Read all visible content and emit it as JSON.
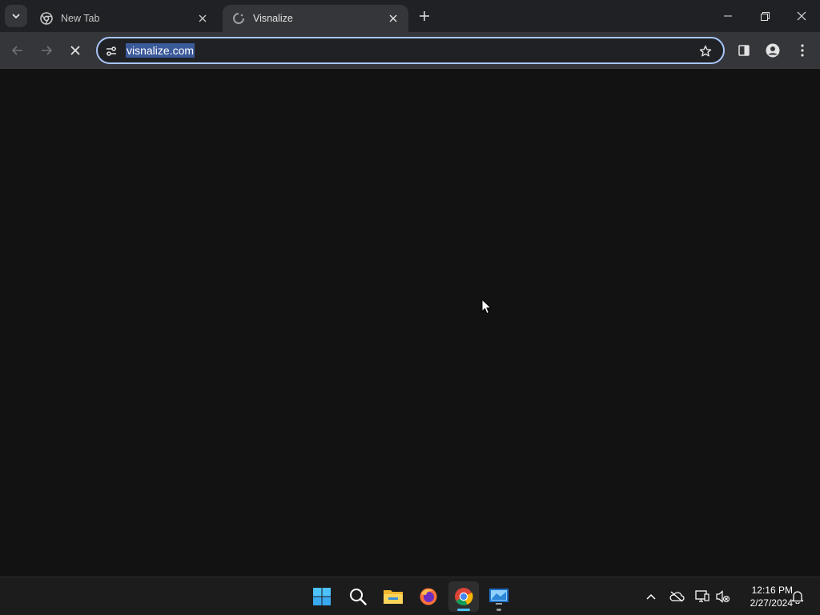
{
  "browser": {
    "tabs": [
      {
        "title": "New Tab",
        "favicon": "chrome-icon",
        "active": false
      },
      {
        "title": "Visnalize",
        "favicon": "loading-spinner-icon",
        "active": true
      }
    ],
    "address_bar": {
      "url": "visnalize.com",
      "site_info_icon": "tune-icon",
      "selected": true
    },
    "toolbar_icons": [
      "back-arrow-icon",
      "forward-arrow-icon",
      "stop-loading-icon",
      "bookmark-star-icon",
      "side-panel-icon",
      "profile-icon",
      "menu-kebab-icon"
    ]
  },
  "taskbar": {
    "apps": [
      "windows-start-icon",
      "search-icon",
      "file-explorer-icon",
      "firefox-icon",
      "chrome-icon",
      "remote-desktop-icon"
    ],
    "active_app": "chrome-icon",
    "clock": {
      "time": "12:16 PM",
      "date": "2/27/2024"
    },
    "tray_icons": [
      "chevron-up-icon",
      "onedrive-offline-icon",
      "network-icon",
      "volume-muted-icon",
      "notification-bell-icon"
    ]
  },
  "colors": {
    "tabstrip_bg": "#202124",
    "toolbar_bg": "#35363a",
    "content_bg": "#121212",
    "taskbar_bg": "#1c1c1c",
    "omnibox_border": "#a8c7fa",
    "selection": "#3b5a9a"
  }
}
